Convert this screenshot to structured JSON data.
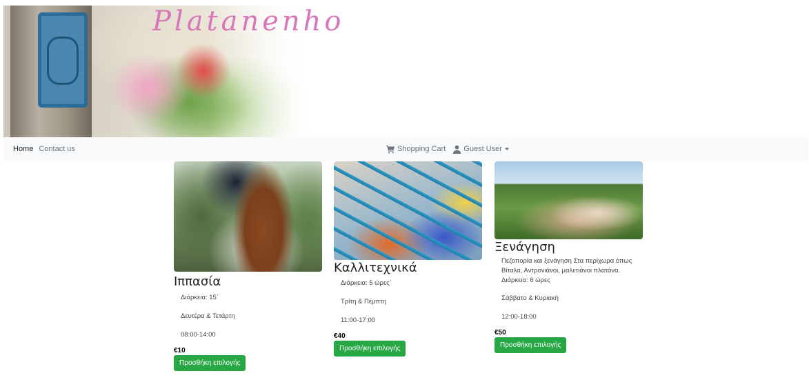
{
  "header": {
    "brand_title": "Platanenhof"
  },
  "nav": {
    "links": [
      {
        "label": "Home"
      },
      {
        "label": "Contact us"
      }
    ],
    "cart_label": "Shopping Cart",
    "user_label": "Guest User"
  },
  "cards": [
    {
      "title": "Ιππασία",
      "lines": [
        "Διάρκεια: 15΄",
        "Δευτέρα & Τετάρτη",
        "08:00-14:00"
      ],
      "price": "€10",
      "button": "Προσθήκη επιλογής"
    },
    {
      "title": "Καλλιτεχνικά",
      "lines": [
        "Διάρκεια: 5 ώρες΄",
        "Τρίτη & Πέμπτη",
        "11:00-17:00"
      ],
      "price": "€40",
      "button": "Προσθήκη επιλογής"
    },
    {
      "title": "Ξενάγηση",
      "description": "Πεζοπορία και ξενάγηση Στα περίχωρα όπως Βίταλα, Αντρονιάνοι, μαλετιάνοι πλατάνα. Διάρκεια: 6 ώρες",
      "lines": [
        "Σάββατο & Κυριακή",
        "12:00-18:00"
      ],
      "price": "€50",
      "button": "Προσθήκη επιλογής"
    }
  ],
  "colors": {
    "navbar_bg": "#f8f9fa",
    "button_green": "#28a745",
    "brand_pink": "#d776b8"
  },
  "icons": {
    "cart": "shopping-cart-icon",
    "user": "user-icon",
    "caret": "caret-down-icon"
  }
}
